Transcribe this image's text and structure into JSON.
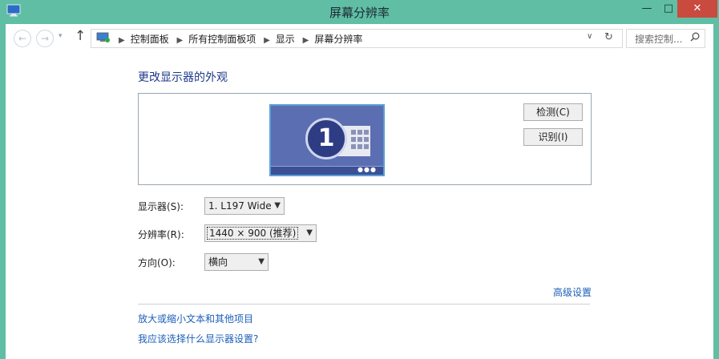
{
  "window": {
    "title": "屏幕分辨率",
    "minimize": "—",
    "maximize": "□",
    "close": "✕"
  },
  "nav": {
    "back_icon": "left-arrow-icon",
    "forward_icon": "right-arrow-icon",
    "dropdown": "▾",
    "up": "↑",
    "breadcrumbs": [
      "控制面板",
      "所有控制面板项",
      "显示",
      "屏幕分辨率"
    ],
    "address_dropdown": "∨",
    "refresh": "↻",
    "search_placeholder": "搜索控制..."
  },
  "main": {
    "heading": "更改显示器的外观",
    "monitor_number": "1",
    "dots": "●●●",
    "detect_label": "检测(C)",
    "identify_label": "识别(I)",
    "display_label": "显示器(S):",
    "display_value": "1. L197 Wide",
    "resolution_label": "分辨率(R):",
    "resolution_value": "1440 × 900 (推荐)",
    "orientation_label": "方向(O):",
    "orientation_value": "横向",
    "advanced_link": "高级设置",
    "text_size_link": "放大或缩小文本和其他项目",
    "which_display_link": "我应该选择什么显示器设置?"
  },
  "colors": {
    "frame": "#5fbea4",
    "link": "#1c5fb6",
    "heading": "#1c3a8c",
    "close_button": "#c94a3f",
    "monitor": "#5b6eb2"
  }
}
